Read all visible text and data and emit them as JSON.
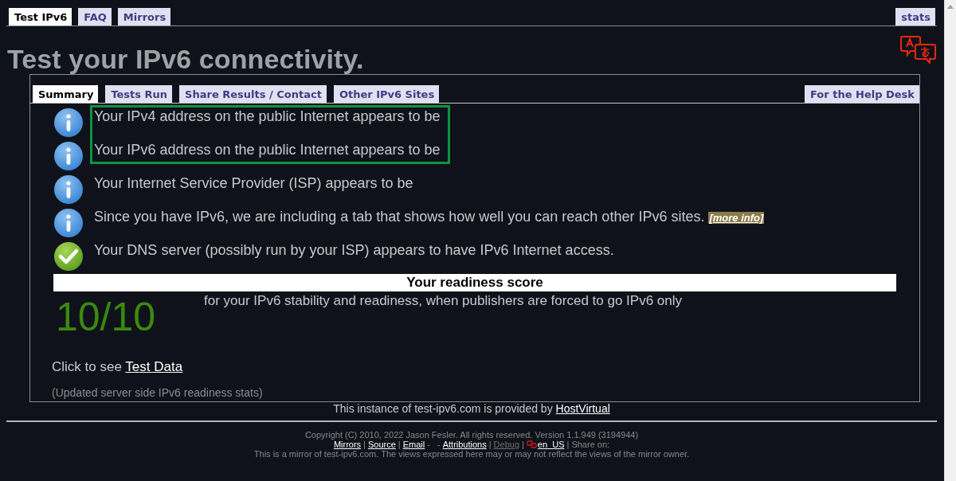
{
  "top_tabs": [
    {
      "label": "Test IPv6",
      "selected": true
    },
    {
      "label": "FAQ",
      "selected": false
    },
    {
      "label": "Mirrors",
      "selected": false
    }
  ],
  "top_right_tab": {
    "label": "stats",
    "selected": false
  },
  "heading": "Test your IPv6 connectivity.",
  "panel": {
    "tabs": [
      {
        "label": "Summary",
        "selected": true
      },
      {
        "label": "Tests Run",
        "selected": false
      },
      {
        "label": "Share Results / Contact",
        "selected": false
      },
      {
        "label": "Other IPv6 Sites",
        "selected": false
      }
    ],
    "right_tab": {
      "label": "For the Help Desk",
      "selected": false
    },
    "messages": [
      {
        "kind": "info",
        "highlighted": true,
        "text": "Your IPv4 address on the public Internet appears to be"
      },
      {
        "kind": "info",
        "highlighted": true,
        "text": "Your IPv6 address on the public Internet appears to be"
      },
      {
        "kind": "info",
        "highlighted": false,
        "text": "Your Internet Service Provider (ISP) appears to be"
      },
      {
        "kind": "info",
        "highlighted": false,
        "text": "Since you have IPv6, we are including a tab that shows how well you can reach other IPv6 sites.",
        "link": "[more info]"
      },
      {
        "kind": "ok",
        "highlighted": false,
        "text": "Your DNS server (possibly run by your ISP) appears to have IPv6 Internet access."
      }
    ],
    "score_title": "Your readiness score",
    "score": "10/10",
    "score_description": "for your IPv6 stability and readiness, when publishers are forced to go IPv6 only",
    "test_data_prompt": "Click to see",
    "test_data_link": "Test Data",
    "stats_note": "(Updated server side IPv6 readiness stats)"
  },
  "instance": {
    "text": "This instance of test-ipv6.com is provided by",
    "link": "HostVirtual"
  },
  "footer": {
    "copyright": "Copyright (C) 2010, 2022 Jason Fesler. All rights reserved. Version 1.1.949 (3194944)",
    "links": [
      {
        "kind": "link",
        "text": "Mirrors"
      },
      {
        "kind": "separator",
        "text": "|"
      },
      {
        "kind": "link",
        "text": "Source"
      },
      {
        "kind": "separator",
        "text": "|"
      },
      {
        "kind": "link",
        "text": "Email"
      },
      {
        "kind": "separator",
        "text": "-   -"
      },
      {
        "kind": "link",
        "text": "Attributions"
      },
      {
        "kind": "separator",
        "text": "|"
      },
      {
        "kind": "muted",
        "text": "Debug"
      },
      {
        "kind": "separator",
        "text": "|"
      },
      {
        "kind": "locale",
        "text": "en_US"
      },
      {
        "kind": "separator",
        "text": "| Share on:"
      }
    ],
    "mirror_note": "This is a mirror of test-ipv6.com. The views expressed here may or may not reflect the views of the mirror owner."
  }
}
